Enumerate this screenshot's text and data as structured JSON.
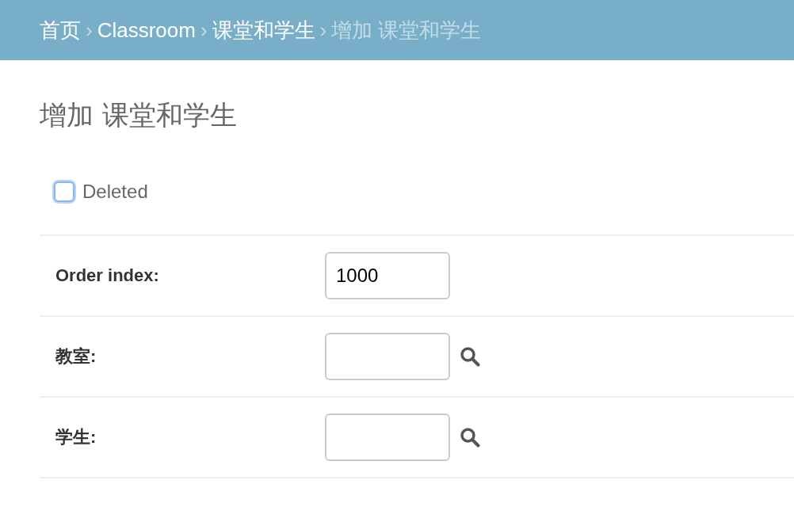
{
  "breadcrumbs": [
    {
      "label": "首页",
      "current": false
    },
    {
      "separator": "›",
      "label": "Classroom",
      "current": false
    },
    {
      "separator": "›",
      "label": "课堂和学生",
      "current": false
    },
    {
      "separator": "›",
      "label": "增加 课堂和学生",
      "current": true
    }
  ],
  "title": "增加 课堂和学生",
  "deleted": {
    "label": "Deleted",
    "checked": false
  },
  "fields": [
    {
      "label": "Order index:",
      "kind": "text",
      "value": "1000"
    },
    {
      "label": "教室:",
      "kind": "lookup"
    },
    {
      "label": "学生:",
      "kind": "lookup"
    }
  ]
}
